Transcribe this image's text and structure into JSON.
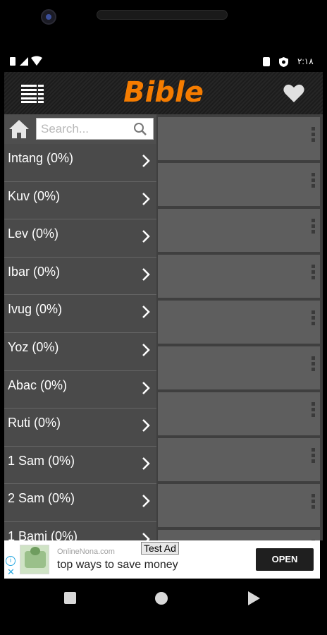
{
  "status_bar": {
    "time": "٢:١٨",
    "icons": [
      "sim-icon",
      "signal-icon",
      "wifi-icon",
      "battery-icon",
      "shield-icon"
    ]
  },
  "app_bar": {
    "title": "Bible",
    "title_color": "#f57c00",
    "left_icon": "menu-list-icon",
    "right_icon": "heart-icon"
  },
  "search": {
    "placeholder": "Search..."
  },
  "books": [
    {
      "label": "Intang (0%)"
    },
    {
      "label": "Kuv (0%)"
    },
    {
      "label": "Lev (0%)"
    },
    {
      "label": "Ibar (0%)"
    },
    {
      "label": "Ivug (0%)"
    },
    {
      "label": "Yoz (0%)"
    },
    {
      "label": "Abac (0%)"
    },
    {
      "label": "Ruti (0%)"
    },
    {
      "label": "1 Sam (0%)"
    },
    {
      "label": "2 Sam (0%)"
    },
    {
      "label": "1 Bami (0%)"
    }
  ],
  "ad": {
    "badge": "Test Ad",
    "source": "OnlineNona.com",
    "headline": "top ways to save money",
    "cta": "OPEN",
    "info_glyph": "i",
    "close_glyph": "✕"
  },
  "nav_bar": {
    "icons": [
      "recents-icon",
      "home-icon",
      "back-icon"
    ]
  }
}
